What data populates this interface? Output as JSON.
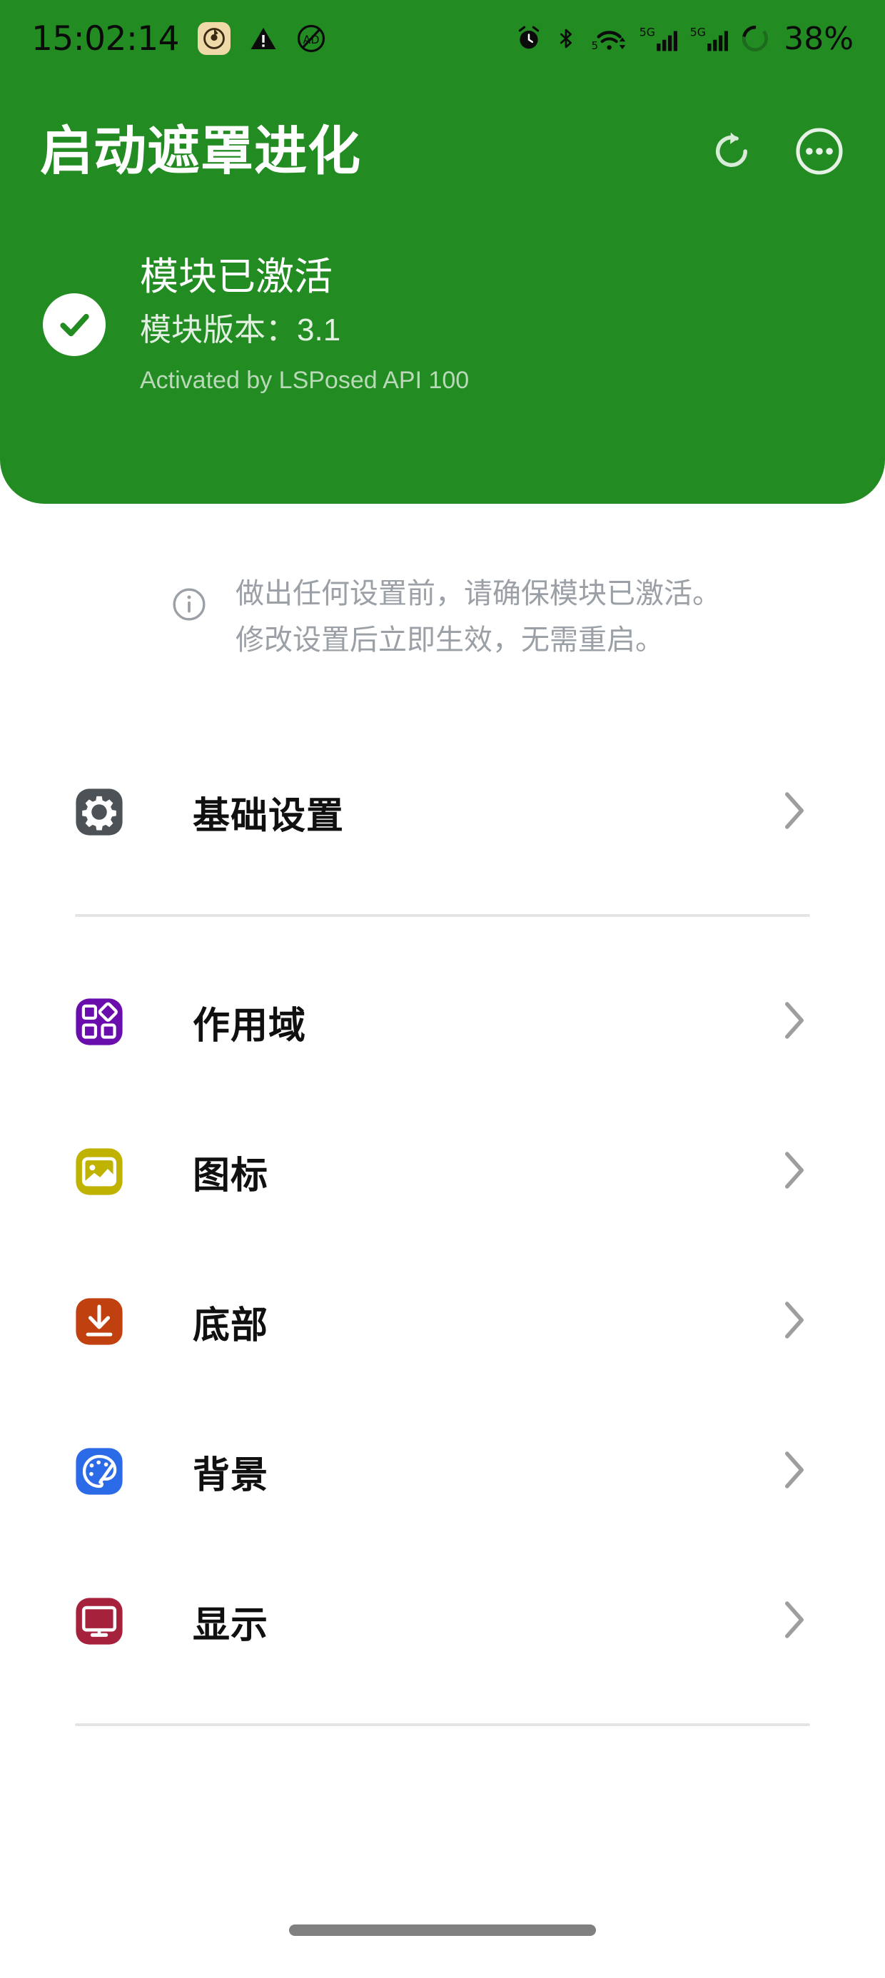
{
  "statusbar": {
    "time": "15:02:14",
    "battery_percent": "38%",
    "icons": [
      {
        "name": "app-notification-icon",
        "label": "app"
      },
      {
        "name": "warning-triangle-icon",
        "label": "warning"
      },
      {
        "name": "no-ads-icon",
        "label": "ad-block"
      },
      {
        "name": "alarm-clock-icon",
        "label": "alarm"
      },
      {
        "name": "bluetooth-icon",
        "label": "bluetooth"
      },
      {
        "name": "wifi-5ghz-icon",
        "label": "wifi 5"
      },
      {
        "name": "signal-5g-sim1-icon",
        "label": "5G"
      },
      {
        "name": "signal-5g-sim2-icon",
        "label": "5G"
      },
      {
        "name": "battery-ring-icon",
        "label": "battery"
      }
    ]
  },
  "header": {
    "title": "启动遮罩进化",
    "refresh_label": "refresh",
    "more_label": "more",
    "accent_color": "#228B22"
  },
  "status_card": {
    "title": "模块已激活",
    "version": "模块版本：3.1",
    "api": "Activated by LSPosed API 100",
    "check_icon": "check-circle-icon"
  },
  "notice": {
    "icon": "info-circle-icon",
    "lines": [
      "做出任何设置前，请确保模块已激活。",
      "修改设置后立即生效，无需重启。"
    ]
  },
  "menu": {
    "group1": [
      {
        "label": "基础设置",
        "icon": "gear-icon",
        "icon_color": "#4C5256",
        "chevron": "chevron-right-icon"
      }
    ],
    "group2": [
      {
        "label": "作用域",
        "icon": "dashboard-icon",
        "icon_color": "#6A0DAD",
        "chevron": "chevron-right-icon"
      },
      {
        "label": "图标",
        "icon": "image-icon",
        "icon_color": "#BFB200",
        "chevron": "chevron-right-icon"
      },
      {
        "label": "底部",
        "icon": "download-icon",
        "icon_color": "#C0400F",
        "chevron": "chevron-right-icon"
      },
      {
        "label": "背景",
        "icon": "palette-icon",
        "icon_color": "#2B6BE8",
        "chevron": "chevron-right-icon"
      },
      {
        "label": "显示",
        "icon": "monitor-icon",
        "icon_color": "#A6223C",
        "chevron": "chevron-right-icon"
      }
    ]
  },
  "navbar": {
    "handle": "gesture-home-handle"
  }
}
